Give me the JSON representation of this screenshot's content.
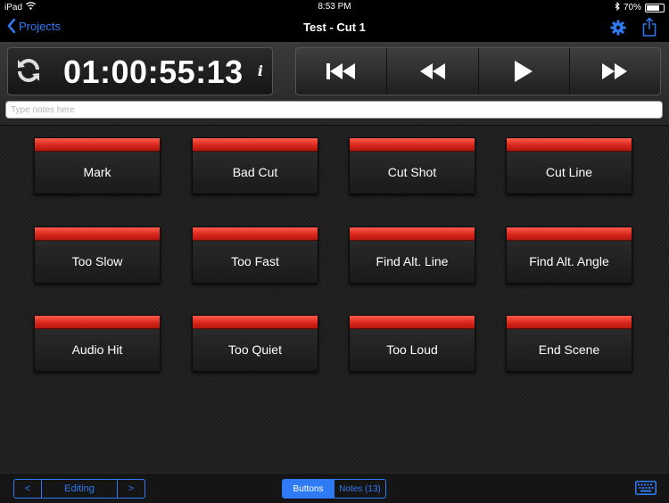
{
  "status_bar": {
    "device": "iPad",
    "time": "8:53 PM",
    "battery": "70%",
    "battery_level": 0.7
  },
  "nav": {
    "back_label": "Projects",
    "title": "Test - Cut 1",
    "icons": [
      "chevron-left-icon",
      "gear-icon",
      "share-icon"
    ]
  },
  "timecode": {
    "value": "01:00:55:13",
    "info_label": "i"
  },
  "transport": {
    "buttons": [
      "skip-to-start-icon",
      "rewind-icon",
      "play-icon",
      "fast-forward-icon"
    ]
  },
  "notes": {
    "placeholder": "Type notes here"
  },
  "marker_buttons": [
    {
      "label": "Mark"
    },
    {
      "label": "Bad Cut"
    },
    {
      "label": "Cut Shot"
    },
    {
      "label": "Cut Line"
    },
    {
      "label": "Too Slow"
    },
    {
      "label": "Too Fast"
    },
    {
      "label": "Find Alt. Line"
    },
    {
      "label": "Find Alt. Angle"
    },
    {
      "label": "Audio Hit"
    },
    {
      "label": "Too Quiet"
    },
    {
      "label": "Too Loud"
    },
    {
      "label": "End Scene"
    }
  ],
  "bottom": {
    "prev_label": "<",
    "page_label": "Editing",
    "next_label": ">",
    "seg_buttons": "Buttons",
    "seg_notes": "Notes (13)"
  },
  "colors": {
    "accent": "#2f7bf5",
    "marker_red": "#e0281c"
  }
}
